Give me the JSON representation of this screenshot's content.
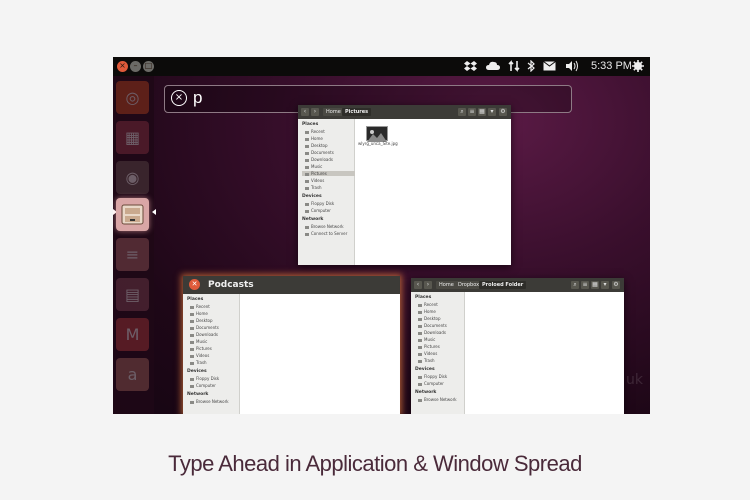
{
  "topbar": {
    "close": "×",
    "min": "–",
    "max": "□",
    "clock": "5:33 PM",
    "indicators": [
      "dropbox-icon",
      "cloud-icon",
      "network-icon",
      "bluetooth-icon",
      "mail-icon",
      "volume-icon",
      "gear-icon"
    ]
  },
  "search": {
    "clear": "×",
    "query": "p"
  },
  "launcher": {
    "icons": [
      "ubuntu-icon",
      "apps-icon",
      "disk-icon",
      "files-icon",
      "document-icon",
      "spreadsheet-icon",
      "gmail-icon",
      "amazon-icon"
    ]
  },
  "pictures_window": {
    "crumbs": [
      "Home",
      "Pictures"
    ],
    "places_header": "Places",
    "places": [
      "Recent",
      "Home",
      "Desktop",
      "Documents",
      "Downloads",
      "Music",
      "Pictures",
      "Videos",
      "Trash"
    ],
    "devices_header": "Devices",
    "devices": [
      "Floppy Disk",
      "Computer"
    ],
    "network_header": "Network",
    "network": [
      "Browse Network",
      "Connect to Server"
    ],
    "file_name": "wlyrg_unca_Site.jpg"
  },
  "podcasts_window": {
    "title": "Podcasts",
    "places_header": "Places",
    "places": [
      "Recent",
      "Home",
      "Desktop",
      "Documents",
      "Downloads",
      "Music",
      "Pictures",
      "Videos",
      "Trash"
    ],
    "devices_header": "Devices",
    "devices": [
      "Floppy Disk",
      "Computer"
    ],
    "network_header": "Network",
    "network": [
      "Browse Network"
    ]
  },
  "proloed_window": {
    "crumbs": [
      "Home",
      "Dropbox",
      "Proloed Folder"
    ],
    "places_header": "Places",
    "places": [
      "Recent",
      "Home",
      "Desktop",
      "Documents",
      "Downloads",
      "Music",
      "Pictures",
      "Videos",
      "Trash"
    ],
    "devices_header": "Devices",
    "devices": [
      "Floppy Disk",
      "Computer"
    ],
    "network_header": "Network",
    "network": [
      "Browse Network"
    ]
  },
  "watermark": "uk",
  "caption": "Type Ahead in Application & Window Spread"
}
